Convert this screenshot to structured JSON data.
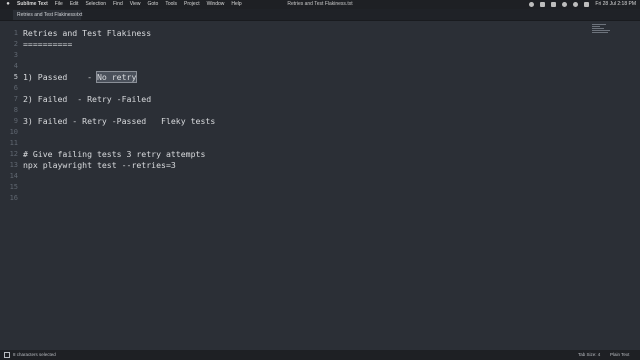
{
  "menubar": {
    "app": "Sublime Text",
    "items": [
      "File",
      "Edit",
      "Selection",
      "Find",
      "View",
      "Goto",
      "Tools",
      "Project",
      "Window",
      "Help"
    ],
    "window_title": "Retries and Test Flakiness.txt",
    "clock": "Fri 28 Jul  2:18 PM"
  },
  "tab": {
    "label": "Retries and Test Flakiness.txt",
    "close": "×"
  },
  "editor": {
    "line_numbers": [
      "1",
      "2",
      "3",
      "4",
      "5",
      "6",
      "7",
      "8",
      "9",
      "10",
      "11",
      "12",
      "13",
      "14",
      "15",
      "16"
    ],
    "active_line": 5,
    "lines": [
      "Retries and Test Flakiness",
      "==========",
      "",
      "",
      "1) Passed    - ",
      "",
      "2) Failed  - Retry -Failed",
      "",
      "3) Failed - Retry -Passed   Fleky tests",
      "",
      "",
      "# Give failing tests 3 retry attempts",
      "npx playwright test --retries=3",
      "",
      "",
      ""
    ],
    "selected_text": "No retry"
  },
  "statusbar": {
    "selection": "8 characters selected",
    "tab_size": "Tab Size: 4",
    "syntax": "Plain Text"
  }
}
